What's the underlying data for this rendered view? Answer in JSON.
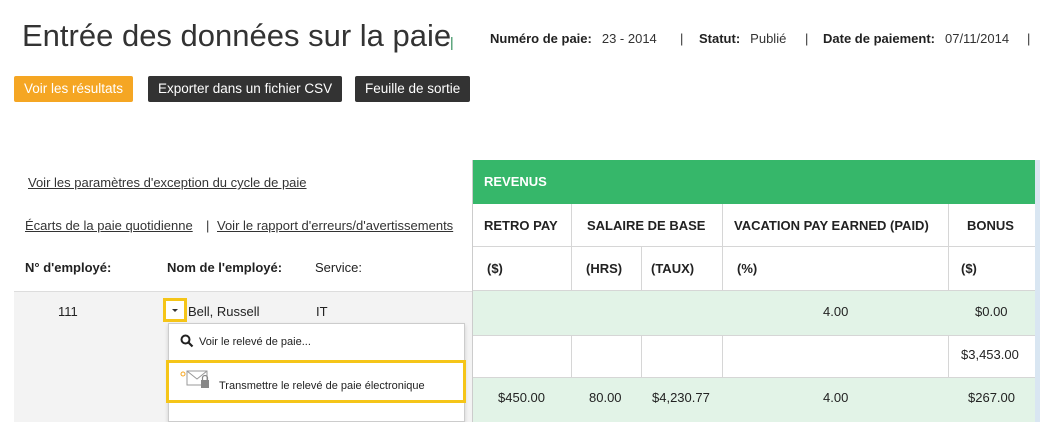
{
  "header": {
    "title": "Entrée des données sur la paie",
    "title_sep": "|",
    "payrun_label": "Numéro de paie:",
    "payrun_value": "23 - 2014",
    "status_label": "Statut:",
    "status_value": "Publié",
    "paydate_label": "Date de paiement:",
    "paydate_value": "07/11/2014",
    "sep": "|"
  },
  "toolbar": {
    "view_results": "Voir les résultats",
    "export_csv": "Exporter dans un fichier CSV",
    "output_sheet": "Feuille de sortie"
  },
  "links": {
    "exception_params": "Voir les paramètres d'exception du cycle de paie",
    "daily_variance": "Écarts de la paie quotidienne",
    "error_report": "Voir le rapport d'erreurs/d'avertissements",
    "sep": "|"
  },
  "columns_left": {
    "emp_no": "N° d'employé:",
    "emp_name": "Nom de l'employé:",
    "service": "Service:"
  },
  "grid": {
    "band": "REVENUS",
    "headers": [
      "RETRO PAY",
      "SALAIRE DE BASE",
      "VACATION PAY EARNED (PAID)",
      "BONUS"
    ],
    "units": [
      "($)",
      "(HRS)",
      "(TAUX)",
      "(%)",
      "($)"
    ]
  },
  "employee": {
    "number": "111",
    "name": "Bell, Russell",
    "service": "IT"
  },
  "rows": [
    {
      "retro": "",
      "hrs": "",
      "rate": "",
      "vac": "4.00",
      "bonus": "$0.00"
    },
    {
      "retro": "",
      "hrs": "",
      "rate": "",
      "vac": "",
      "bonus": "$3,453.00"
    },
    {
      "retro": "$450.00",
      "hrs": "80.00",
      "rate": "$4,230.77",
      "vac": "4.00",
      "bonus": "$267.00"
    }
  ],
  "popup": {
    "view_paystub": "Voir le relevé de paie...",
    "send_epaystub": "Transmettre le relevé de paie électronique"
  },
  "colors": {
    "accent_orange": "#f5a623",
    "band_green": "#36b76a",
    "row_green": "#e2f3e7",
    "highlight_yellow": "#f5c518"
  }
}
